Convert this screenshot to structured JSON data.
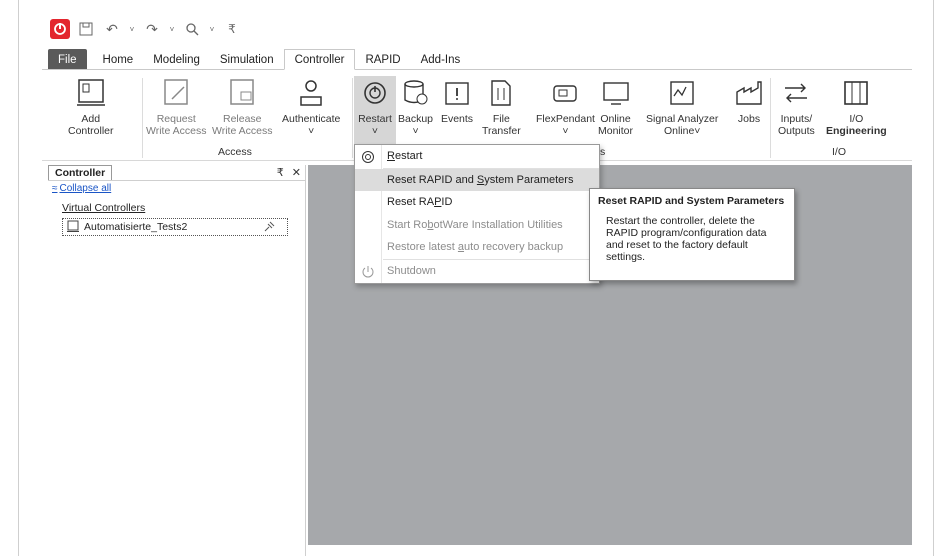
{
  "ribbon_tabs": [
    "File",
    "Home",
    "Modeling",
    "Simulation",
    "Controller",
    "RAPID",
    "Add-Ins"
  ],
  "active_tab": "Controller",
  "ribbon": {
    "add_controller": [
      "Add",
      "Controller"
    ],
    "request_write": [
      "Request",
      "Write Access"
    ],
    "release_write": [
      "Release",
      "Write Access"
    ],
    "authenticate": [
      "Authenticate"
    ],
    "restart": [
      "Restart"
    ],
    "backup": [
      "Backup"
    ],
    "events": [
      "Events"
    ],
    "file_transfer": [
      "File",
      "Transfer"
    ],
    "flexpendant": [
      "FlexPendant"
    ],
    "online_monitor": [
      "Online",
      "Monitor"
    ],
    "signal_analyzer": [
      "Signal Analyzer",
      "Online"
    ],
    "jobs": [
      "Jobs"
    ],
    "inputs_outputs": [
      "Inputs/",
      "Outputs"
    ],
    "io_engineering": [
      "I/O",
      "Engineering"
    ],
    "group_access": "Access",
    "group_s": "s",
    "group_io": "I/O"
  },
  "panel": {
    "tab_label": "Controller",
    "collapse_label": "Collapse all",
    "tree_root": "Virtual Controllers",
    "tree_item": "Automatisierte_Tests2"
  },
  "menu": {
    "items": [
      {
        "pre": "",
        "ul": "R",
        "post": "estart"
      },
      {
        "pre": "Reset RAPID and ",
        "ul": "S",
        "post": "ystem Parameters"
      },
      {
        "pre": "Reset RA",
        "ul": "P",
        "post": "ID"
      },
      {
        "pre": "Start Ro",
        "ul": "b",
        "post": "otWare Installation Utilities"
      },
      {
        "pre": "Restore latest ",
        "ul": "a",
        "post": "uto recovery backup"
      },
      {
        "pre": "Shutdown",
        "ul": "",
        "post": ""
      }
    ]
  },
  "tooltip": {
    "title": "Reset RAPID and System Parameters",
    "body": "Restart the controller, delete the RAPID program/configuration data and reset to the factory default settings."
  },
  "colors": {
    "accent_red": "#e3262e",
    "workspace_gray": "#a6a8ab",
    "file_tab": "#5a5a5a",
    "link_blue": "#1a55c6"
  }
}
